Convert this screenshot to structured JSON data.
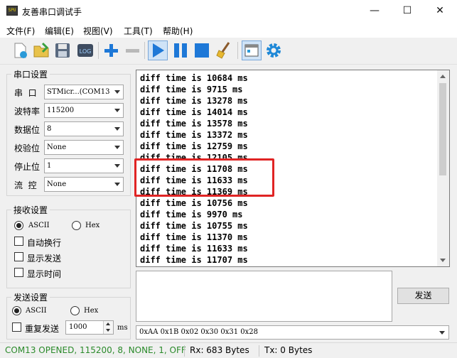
{
  "window": {
    "title": "友善串口调试手",
    "icon_text": "SPU",
    "minimize": "—",
    "maximize": "☐",
    "close": "✕"
  },
  "menu": [
    "文件(F)",
    "编辑(E)",
    "视图(V)",
    "工具(T)",
    "帮助(H)"
  ],
  "toolbar": {
    "log_label": "LOG",
    "icons": [
      "new-icon",
      "open-icon",
      "save-icon",
      "log-icon",
      "plus-icon",
      "minus-icon",
      "play-icon",
      "pause-icon",
      "stop-icon",
      "broom-icon",
      "layout-icon",
      "gear-icon"
    ]
  },
  "serial_settings": {
    "title": "串口设置",
    "port_label": "串  口",
    "port_value": "STMicr...(COM13",
    "baud_label": "波特率",
    "baud_value": "115200",
    "databits_label": "数据位",
    "databits_value": "8",
    "parity_label": "校验位",
    "parity_value": "None",
    "stopbits_label": "停止位",
    "stopbits_value": "1",
    "flow_label": "流  控",
    "flow_value": "None"
  },
  "receive_settings": {
    "title": "接收设置",
    "ascii_label": "ASCII",
    "hex_label": "Hex",
    "mode": "ascii",
    "auto_newline": "自动换行",
    "show_send": "显示发送",
    "show_time": "显示时间"
  },
  "send_settings": {
    "title": "发送设置",
    "ascii_label": "ASCII",
    "hex_label": "Hex",
    "mode": "ascii",
    "repeat_label": "重复发送",
    "repeat_interval": "1000",
    "unit": "ms"
  },
  "receive_lines": [
    "diff time is 10684 ms",
    "diff time is 9715 ms",
    "diff time is 13278 ms",
    "diff time is 14014 ms",
    "diff time is 13578 ms",
    "diff time is 13372 ms",
    "diff time is 12759 ms",
    "diff time is 12105 ms",
    "diff time is 11708 ms",
    "diff time is 11633 ms",
    "diff time is 11369 ms",
    "diff time is 10756 ms",
    "diff time is 9970 ms",
    "diff time is 10755 ms",
    "diff time is 11370 ms",
    "diff time is 11633 ms",
    "diff time is 11707 ms"
  ],
  "send": {
    "button_label": "发送",
    "history_value": "0xAA 0x1B 0x02 0x30 0x31 0x28"
  },
  "status": {
    "connection": "COM13 OPENED, 115200, 8, NONE, 1, OFF",
    "rx": "Rx: 683 Bytes",
    "tx": "Tx: 0 Bytes"
  },
  "colors": {
    "status_ok": "#2a8a2a",
    "highlight": "#e02424",
    "toolbar_blue": "#1e78d7"
  }
}
